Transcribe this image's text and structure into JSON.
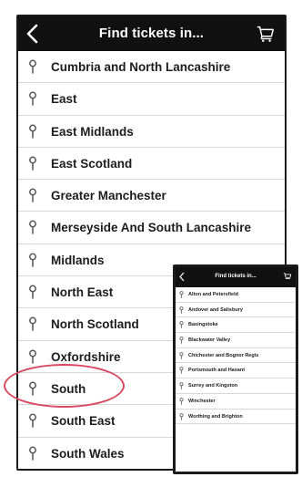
{
  "header": {
    "title": "Find tickets in...",
    "back_icon": "chevron-left-icon",
    "cart_icon": "cart-icon"
  },
  "regions": [
    {
      "label": "Cumbria and North Lancashire"
    },
    {
      "label": "East"
    },
    {
      "label": "East Midlands"
    },
    {
      "label": "East Scotland"
    },
    {
      "label": "Greater Manchester"
    },
    {
      "label": "Merseyside And South Lancashire"
    },
    {
      "label": "Midlands"
    },
    {
      "label": "North East"
    },
    {
      "label": "North Scotland"
    },
    {
      "label": "Oxfordshire"
    },
    {
      "label": "South"
    },
    {
      "label": "South East"
    },
    {
      "label": "South Wales"
    }
  ],
  "highlighted_region": "South",
  "inset": {
    "title": "Find tickets in...",
    "items": [
      {
        "label": "Alton and Petersfield"
      },
      {
        "label": "Andover and Salisbury"
      },
      {
        "label": "Basingstoke"
      },
      {
        "label": "Blackwater Valley"
      },
      {
        "label": "Chichester and Bognor Regis"
      },
      {
        "label": "Portsmouth and Havant"
      },
      {
        "label": "Surrey and Kingston"
      },
      {
        "label": "Winchester"
      },
      {
        "label": "Worthing and Brighton"
      }
    ]
  },
  "colors": {
    "header_bg": "#111111",
    "highlight": "#d9485f",
    "pin": "#555555"
  }
}
